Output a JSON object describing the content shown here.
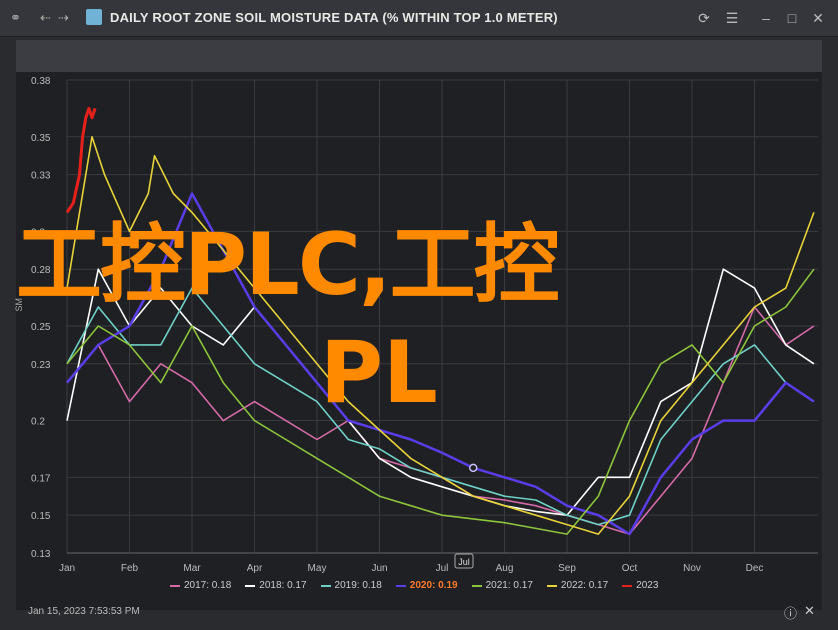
{
  "window": {
    "title": "DAILY ROOT ZONE SOIL MOISTURE DATA (% WITHIN TOP 1.0 METER)",
    "icons": [
      "link-icon",
      "back-arrow-icon",
      "forward-arrow-icon",
      "chart-app-icon",
      "refresh-icon",
      "menu-icon",
      "minimize-icon",
      "maximize-icon",
      "close-icon"
    ]
  },
  "watermark": {
    "line1": "工控PLC,工控",
    "line2": "PL"
  },
  "footer": {
    "date": "Jan 15, 2023 7:53:53 PM",
    "info_icon": "info-icon",
    "close_icon": "close-icon"
  },
  "chart_data": {
    "type": "line",
    "ylabel": "SM",
    "ylim": [
      0.13,
      0.38
    ],
    "yticks": [
      "0.38",
      "0.35",
      "0.33",
      "0.3",
      "0.28",
      "0.25",
      "0.23",
      "0.2",
      "0.17",
      "0.15",
      "0.13"
    ],
    "xticks": [
      "Jan",
      "Feb",
      "Mar",
      "Apr",
      "May",
      "Jun",
      "Jul",
      "Aug",
      "Sep",
      "Oct",
      "Nov",
      "Dec"
    ],
    "x_marker": "Jul",
    "grid": true,
    "legend_position": "bottom",
    "series": [
      {
        "name": "2017: 0.18",
        "color": "#d46aa8",
        "points": [
          [
            0,
            0.22
          ],
          [
            0.5,
            0.24
          ],
          [
            1,
            0.21
          ],
          [
            1.5,
            0.23
          ],
          [
            2,
            0.22
          ],
          [
            2.5,
            0.2
          ],
          [
            3,
            0.21
          ],
          [
            3.5,
            0.2
          ],
          [
            4,
            0.19
          ],
          [
            4.5,
            0.2
          ],
          [
            5,
            0.18
          ],
          [
            5.5,
            0.175
          ],
          [
            6,
            0.17
          ],
          [
            6.5,
            0.16
          ],
          [
            7,
            0.158
          ],
          [
            7.5,
            0.155
          ],
          [
            8,
            0.15
          ],
          [
            8.5,
            0.145
          ],
          [
            9,
            0.14
          ],
          [
            9.5,
            0.16
          ],
          [
            10,
            0.18
          ],
          [
            10.5,
            0.22
          ],
          [
            11,
            0.26
          ],
          [
            11.5,
            0.24
          ],
          [
            11.95,
            0.25
          ]
        ]
      },
      {
        "name": "2018: 0.17",
        "color": "#ffffff",
        "points": [
          [
            0,
            0.2
          ],
          [
            0.5,
            0.28
          ],
          [
            1,
            0.25
          ],
          [
            1.5,
            0.27
          ],
          [
            2,
            0.25
          ],
          [
            2.5,
            0.24
          ],
          [
            3,
            0.26
          ],
          [
            3.5,
            0.24
          ],
          [
            4,
            0.22
          ],
          [
            4.5,
            0.2
          ],
          [
            5,
            0.18
          ],
          [
            5.5,
            0.17
          ],
          [
            6,
            0.165
          ],
          [
            6.5,
            0.16
          ],
          [
            7,
            0.155
          ],
          [
            7.5,
            0.152
          ],
          [
            8,
            0.15
          ],
          [
            8.5,
            0.17
          ],
          [
            9,
            0.17
          ],
          [
            9.5,
            0.21
          ],
          [
            10,
            0.22
          ],
          [
            10.5,
            0.28
          ],
          [
            11,
            0.27
          ],
          [
            11.5,
            0.24
          ],
          [
            11.95,
            0.23
          ]
        ]
      },
      {
        "name": "2019: 0.18",
        "color": "#6fd0c8",
        "points": [
          [
            0,
            0.23
          ],
          [
            0.5,
            0.26
          ],
          [
            1,
            0.24
          ],
          [
            1.5,
            0.24
          ],
          [
            2,
            0.27
          ],
          [
            2.5,
            0.25
          ],
          [
            3,
            0.23
          ],
          [
            3.5,
            0.22
          ],
          [
            4,
            0.21
          ],
          [
            4.5,
            0.19
          ],
          [
            5,
            0.185
          ],
          [
            5.5,
            0.175
          ],
          [
            6,
            0.17
          ],
          [
            6.5,
            0.165
          ],
          [
            7,
            0.16
          ],
          [
            7.5,
            0.158
          ],
          [
            8,
            0.15
          ],
          [
            8.5,
            0.145
          ],
          [
            9,
            0.15
          ],
          [
            9.5,
            0.19
          ],
          [
            10,
            0.21
          ],
          [
            10.5,
            0.23
          ],
          [
            11,
            0.24
          ],
          [
            11.5,
            0.22
          ],
          [
            11.95,
            0.21
          ]
        ]
      },
      {
        "name": "2020: 0.19",
        "color": "#5a3de8",
        "points": [
          [
            0,
            0.22
          ],
          [
            0.5,
            0.24
          ],
          [
            1,
            0.25
          ],
          [
            1.5,
            0.28
          ],
          [
            2,
            0.32
          ],
          [
            2.5,
            0.29
          ],
          [
            3,
            0.26
          ],
          [
            3.5,
            0.24
          ],
          [
            4,
            0.22
          ],
          [
            4.5,
            0.2
          ],
          [
            5,
            0.195
          ],
          [
            5.5,
            0.19
          ],
          [
            6,
            0.183
          ],
          [
            6.5,
            0.175
          ],
          [
            7,
            0.17
          ],
          [
            7.5,
            0.165
          ],
          [
            8,
            0.155
          ],
          [
            8.5,
            0.15
          ],
          [
            9,
            0.14
          ],
          [
            9.5,
            0.17
          ],
          [
            10,
            0.19
          ],
          [
            10.5,
            0.2
          ],
          [
            11,
            0.2
          ],
          [
            11.5,
            0.22
          ],
          [
            11.95,
            0.21
          ]
        ]
      },
      {
        "name": "2021: 0.17",
        "color": "#8cc43c",
        "points": [
          [
            0,
            0.23
          ],
          [
            0.5,
            0.25
          ],
          [
            1,
            0.24
          ],
          [
            1.5,
            0.22
          ],
          [
            2,
            0.25
          ],
          [
            2.5,
            0.22
          ],
          [
            3,
            0.2
          ],
          [
            3.5,
            0.19
          ],
          [
            4,
            0.18
          ],
          [
            4.5,
            0.17
          ],
          [
            5,
            0.16
          ],
          [
            5.5,
            0.155
          ],
          [
            6,
            0.15
          ],
          [
            6.5,
            0.148
          ],
          [
            7,
            0.146
          ],
          [
            7.5,
            0.143
          ],
          [
            8,
            0.14
          ],
          [
            8.5,
            0.16
          ],
          [
            9,
            0.2
          ],
          [
            9.5,
            0.23
          ],
          [
            10,
            0.24
          ],
          [
            10.5,
            0.22
          ],
          [
            11,
            0.25
          ],
          [
            11.5,
            0.26
          ],
          [
            11.95,
            0.28
          ]
        ]
      },
      {
        "name": "2022: 0.17",
        "color": "#e8d23a",
        "points": [
          [
            0,
            0.27
          ],
          [
            0.3,
            0.33
          ],
          [
            0.4,
            0.35
          ],
          [
            0.6,
            0.33
          ],
          [
            1,
            0.3
          ],
          [
            1.3,
            0.32
          ],
          [
            1.4,
            0.34
          ],
          [
            1.7,
            0.32
          ],
          [
            2,
            0.31
          ],
          [
            2.5,
            0.29
          ],
          [
            3,
            0.27
          ],
          [
            3.5,
            0.25
          ],
          [
            4,
            0.23
          ],
          [
            4.5,
            0.21
          ],
          [
            5,
            0.195
          ],
          [
            5.5,
            0.18
          ],
          [
            6,
            0.17
          ],
          [
            6.5,
            0.16
          ],
          [
            7,
            0.155
          ],
          [
            7.5,
            0.15
          ],
          [
            8,
            0.145
          ],
          [
            8.5,
            0.14
          ],
          [
            9,
            0.16
          ],
          [
            9.5,
            0.2
          ],
          [
            10,
            0.22
          ],
          [
            10.5,
            0.24
          ],
          [
            11,
            0.26
          ],
          [
            11.5,
            0.27
          ],
          [
            11.95,
            0.31
          ]
        ]
      },
      {
        "name": "2023",
        "color": "#e8201c",
        "points": [
          [
            0,
            0.31
          ],
          [
            0.1,
            0.315
          ],
          [
            0.2,
            0.33
          ],
          [
            0.25,
            0.35
          ],
          [
            0.3,
            0.36
          ],
          [
            0.35,
            0.365
          ],
          [
            0.4,
            0.36
          ],
          [
            0.45,
            0.365
          ]
        ]
      }
    ]
  }
}
